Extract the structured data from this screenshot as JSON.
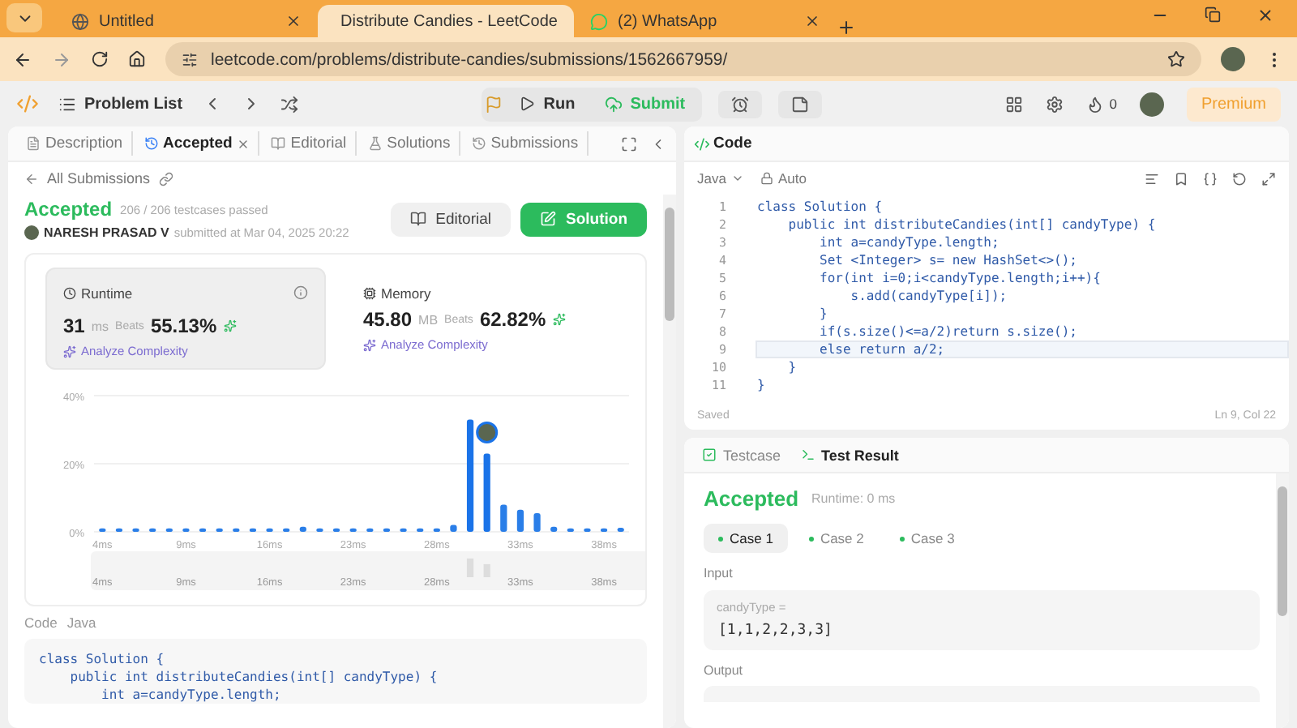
{
  "browser": {
    "tabs": [
      {
        "title": "Untitled",
        "selected": false,
        "kind": "globe"
      },
      {
        "title": "Distribute Candies - LeetCode",
        "selected": true,
        "kind": "leetcode"
      },
      {
        "title": "(2) WhatsApp",
        "selected": false,
        "kind": "whatsapp"
      }
    ],
    "url": "leetcode.com/problems/distribute-candies/submissions/1562667959/"
  },
  "toolbar": {
    "problem_list": "Problem List",
    "run": "Run",
    "submit": "Submit",
    "streak": "0",
    "premium": "Premium"
  },
  "left_tabs": [
    {
      "label": "Description",
      "selected": false,
      "kind": "description"
    },
    {
      "label": "Accepted",
      "selected": true,
      "kind": "accepted"
    },
    {
      "label": "Editorial",
      "selected": false,
      "kind": "editorial"
    },
    {
      "label": "Solutions",
      "selected": false,
      "kind": "solutions"
    },
    {
      "label": "Submissions",
      "selected": false,
      "kind": "submissions"
    }
  ],
  "back_link": "All Submissions",
  "submission": {
    "status": "Accepted",
    "testcases": "206 / 206 testcases passed",
    "author": "NARESH PRASAD V",
    "submitted": "submitted at Mar 04, 2025 20:22",
    "editorial_button": "Editorial",
    "solution_button": "Solution"
  },
  "stats": [
    {
      "kind": "runtime",
      "title": "Runtime",
      "value": "31",
      "unit": "ms",
      "beats_label": "Beats",
      "beats": "55.13%",
      "analyze": "Analyze Complexity",
      "selected": true
    },
    {
      "kind": "memory",
      "title": "Memory",
      "value": "45.80",
      "unit": "MB",
      "beats_label": "Beats",
      "beats": "62.82%",
      "analyze": "Analyze Complexity",
      "selected": false
    }
  ],
  "chart_data": {
    "type": "bar",
    "ylim": [
      0,
      40
    ],
    "yticks": [
      {
        "value": 0,
        "label": "0%"
      },
      {
        "value": 20,
        "label": "20%"
      },
      {
        "value": 40,
        "label": "40%"
      }
    ],
    "values": [
      1,
      1,
      1,
      1,
      1,
      1,
      1,
      1,
      1,
      1,
      1,
      1,
      1.5,
      1,
      1,
      1,
      1,
      1,
      1,
      1,
      1,
      2,
      33,
      23,
      8,
      6.5,
      5.5,
      1.5,
      1,
      1,
      1,
      1.2
    ]
  },
  "axis_labels": [
    "4ms",
    "9ms",
    "16ms",
    "23ms",
    "28ms",
    "33ms",
    "38ms"
  ],
  "brush_labels": [
    "4ms",
    "9ms",
    "16ms",
    "23ms",
    "28ms",
    "33ms",
    "38ms"
  ],
  "code_label": "Code",
  "code_language": "Java",
  "code_preview": [
    "class Solution {",
    "    public int distributeCandies(int[] candyType) {",
    "        int a=candyType.length;"
  ],
  "editor": {
    "title": "Code",
    "language": "Java",
    "mode": "Auto",
    "lines": [
      {
        "number": "1",
        "text": "class Solution {",
        "selected": false
      },
      {
        "number": "2",
        "text": "    public int distributeCandies(int[] candyType) {",
        "selected": false
      },
      {
        "number": "3",
        "text": "        int a=candyType.length;",
        "selected": false
      },
      {
        "number": "4",
        "text": "        Set <Integer> s= new HashSet<>();",
        "selected": false
      },
      {
        "number": "5",
        "text": "        for(int i=0;i<candyType.length;i++){",
        "selected": false
      },
      {
        "number": "6",
        "text": "            s.add(candyType[i]);",
        "selected": false
      },
      {
        "number": "7",
        "text": "        }",
        "selected": false
      },
      {
        "number": "8",
        "text": "        if(s.size()<=a/2)return s.size();",
        "selected": false
      },
      {
        "number": "9",
        "text": "        else return a/2;",
        "selected": true
      },
      {
        "number": "10",
        "text": "    }",
        "selected": false
      },
      {
        "number": "11",
        "text": "}",
        "selected": false
      }
    ],
    "status": "Saved",
    "cursor": "Ln 9, Col 22"
  },
  "test": {
    "tabs": [
      {
        "label": "Testcase",
        "selected": false,
        "kind": "testcase"
      },
      {
        "label": "Test Result",
        "selected": true,
        "kind": "result"
      }
    ],
    "result": "Accepted",
    "runtime": "Runtime: 0 ms",
    "cases": [
      {
        "label": "Case 1",
        "selected": true
      },
      {
        "label": "Case 2",
        "selected": false
      },
      {
        "label": "Case 3",
        "selected": false
      }
    ],
    "input_label": "Input",
    "param": "candyType =",
    "value": "[1,1,2,2,3,3]",
    "output_label": "Output"
  }
}
